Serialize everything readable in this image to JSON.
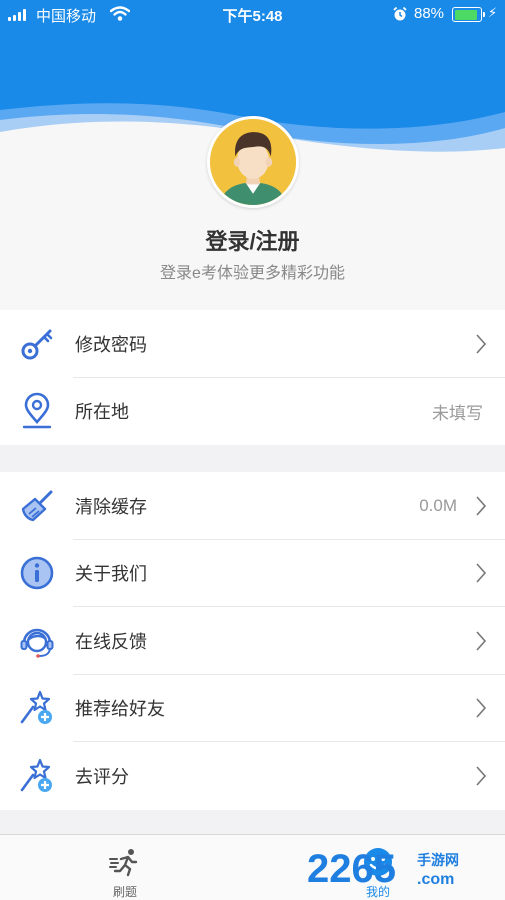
{
  "status_bar": {
    "carrier": "中国移动",
    "time": "下午5:48",
    "battery": "88%",
    "battery_level": 0.88
  },
  "profile": {
    "title": "登录/注册",
    "subtitle": "登录e考体验更多精彩功能"
  },
  "settings_group1": [
    {
      "label": "修改密码",
      "icon": "key-icon",
      "value": ""
    },
    {
      "label": "所在地",
      "icon": "location-pin-icon",
      "value": "未填写"
    }
  ],
  "settings_group2": [
    {
      "label": "清除缓存",
      "icon": "broom-icon",
      "value": "0.0M"
    },
    {
      "label": "关于我们",
      "icon": "info-icon",
      "value": ""
    },
    {
      "label": "在线反馈",
      "icon": "headset-icon",
      "value": ""
    },
    {
      "label": "推荐给好友",
      "icon": "magic-wand-plus-icon",
      "value": ""
    },
    {
      "label": "去评分",
      "icon": "magic-wand-plus-icon",
      "value": ""
    }
  ],
  "tabbar": {
    "tabs": [
      {
        "label": "刷题",
        "icon": "running-icon",
        "active": false
      },
      {
        "label": "我的",
        "icon": "smiley-face-icon",
        "active": true
      }
    ]
  },
  "watermark": {
    "brand": "2265",
    "suffix_top": "手游网",
    "suffix_bottom": ".com"
  },
  "colors": {
    "header_blue": "#1a8ae8",
    "accent_icon": "#3a6fd6",
    "active_tab": "#1a8ae8",
    "avatar_bg": "#f2c23f",
    "watermark_blue": "#1f7fe0"
  }
}
